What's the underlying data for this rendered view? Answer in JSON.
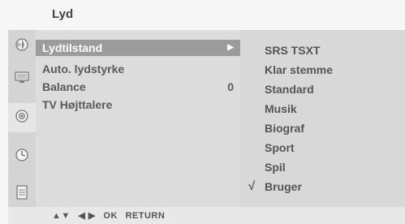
{
  "header": {
    "title": "Lyd"
  },
  "sidebar": {
    "icons": [
      "picture-icon",
      "screen-icon",
      "sound-icon",
      "time-icon",
      "settings-icon"
    ],
    "active_index": 2
  },
  "menu": {
    "items": [
      {
        "label": "Lydtilstand",
        "value": "▶",
        "selected": true
      },
      {
        "label": "Auto. lydstyrke",
        "value": "",
        "selected": false
      },
      {
        "label": "Balance",
        "value": "0",
        "selected": false
      },
      {
        "label": "TV Højttalere",
        "value": "",
        "selected": false
      }
    ]
  },
  "submenu": {
    "options": [
      "SRS TSXT",
      "Klar stemme",
      "Standard",
      "Musik",
      "Biograf",
      "Sport",
      "Spil",
      "Bruger"
    ],
    "checked_index": 7,
    "check_mark": "√"
  },
  "footer": {
    "nav_arrows_ud": "▲▼",
    "nav_arrows_lr": "◀ ▶",
    "ok": "OK",
    "return": "RETURN"
  },
  "colors": {
    "selected_bg": "#9c9c9c",
    "panel_bg": "#dcdcdc"
  }
}
